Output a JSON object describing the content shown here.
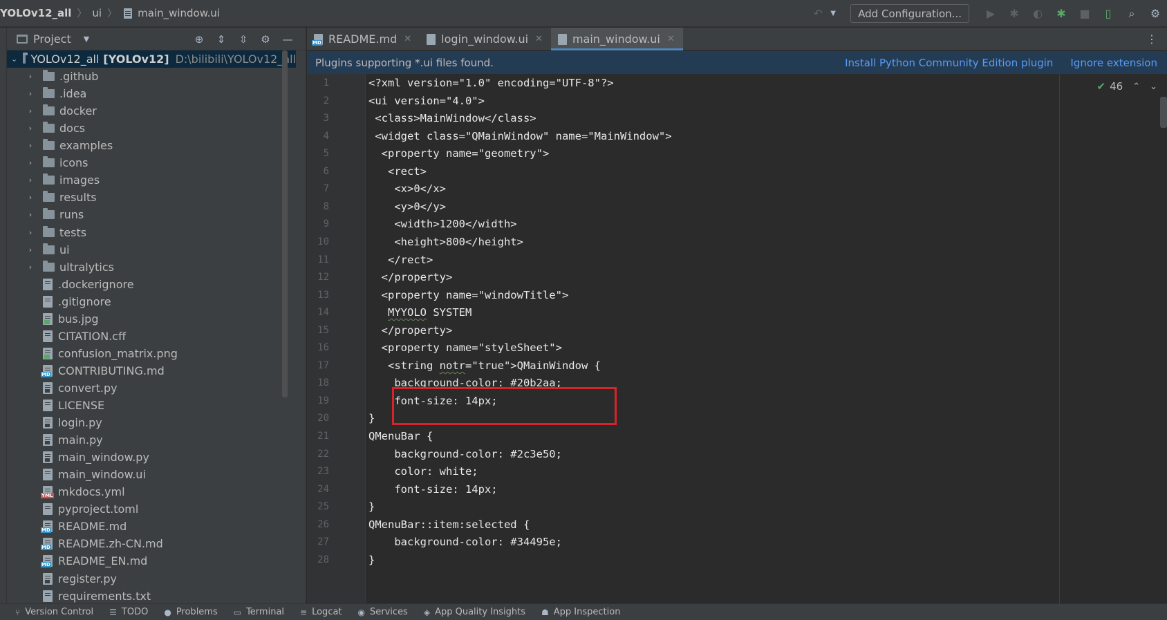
{
  "titlebar": {
    "breadcrumbs": [
      "YOLOv12_all",
      "ui",
      "main_window.ui"
    ],
    "add_configuration": "Add Configuration..."
  },
  "project_panel": {
    "title": "Project",
    "root": {
      "name": "YOLOv12_all",
      "module": "[YOLOv12]",
      "path": "D:\\bilibili\\YOLOv12_all"
    },
    "folders": [
      ".github",
      ".idea",
      "docker",
      "docs",
      "examples",
      "icons",
      "images",
      "results",
      "runs",
      "tests",
      "ui",
      "ultralytics"
    ],
    "files": [
      {
        "name": ".dockerignore",
        "type": "text"
      },
      {
        "name": ".gitignore",
        "type": "text"
      },
      {
        "name": "bus.jpg",
        "type": "img"
      },
      {
        "name": "CITATION.cff",
        "type": "text"
      },
      {
        "name": "confusion_matrix.png",
        "type": "img"
      },
      {
        "name": "CONTRIBUTING.md",
        "type": "md"
      },
      {
        "name": "convert.py",
        "type": "py"
      },
      {
        "name": "LICENSE",
        "type": "text"
      },
      {
        "name": "login.py",
        "type": "py"
      },
      {
        "name": "main.py",
        "type": "py"
      },
      {
        "name": "main_window.py",
        "type": "py"
      },
      {
        "name": "main_window.ui",
        "type": "text"
      },
      {
        "name": "mkdocs.yml",
        "type": "yml"
      },
      {
        "name": "pyproject.toml",
        "type": "text"
      },
      {
        "name": "README.md",
        "type": "md"
      },
      {
        "name": "README.zh-CN.md",
        "type": "md"
      },
      {
        "name": "README_EN.md",
        "type": "md"
      },
      {
        "name": "register.py",
        "type": "py"
      },
      {
        "name": "requirements.txt",
        "type": "text"
      }
    ]
  },
  "tabs": [
    {
      "label": "README.md",
      "active": false,
      "icon": "md"
    },
    {
      "label": "login_window.ui",
      "active": false,
      "icon": "file"
    },
    {
      "label": "main_window.ui",
      "active": true,
      "icon": "file"
    }
  ],
  "notification": {
    "message": "Plugins supporting *.ui files found.",
    "action_install": "Install Python Community Edition plugin",
    "action_ignore": "Ignore extension"
  },
  "inspection": {
    "count": "46"
  },
  "editor": {
    "lines": [
      "<?xml version=\"1.0\" encoding=\"UTF-8\"?>",
      "<ui version=\"4.0\">",
      " <class>MainWindow</class>",
      " <widget class=\"QMainWindow\" name=\"MainWindow\">",
      "  <property name=\"geometry\">",
      "   <rect>",
      "    <x>0</x>",
      "    <y>0</y>",
      "    <width>1200</width>",
      "    <height>800</height>",
      "   </rect>",
      "  </property>",
      "  <property name=\"windowTitle\">",
      "   <string>MYYOLO SYSTEM</string>",
      "  </property>",
      "  <property name=\"styleSheet\">",
      "   <string notr=\"true\">QMainWindow {",
      "    background-color: #20b2aa;",
      "    font-size: 14px;",
      "}",
      "QMenuBar {",
      "    background-color: #2c3e50;",
      "    color: white;",
      "    font-size: 14px;",
      "}",
      "QMenuBar::item:selected {",
      "    background-color: #34495e;",
      "}"
    ]
  },
  "bottom_tools": [
    "Version Control",
    "TODO",
    "Problems",
    "Terminal",
    "Logcat",
    "Services",
    "App Quality Insights",
    "App Inspection"
  ],
  "highlight_color": "#d8232a"
}
